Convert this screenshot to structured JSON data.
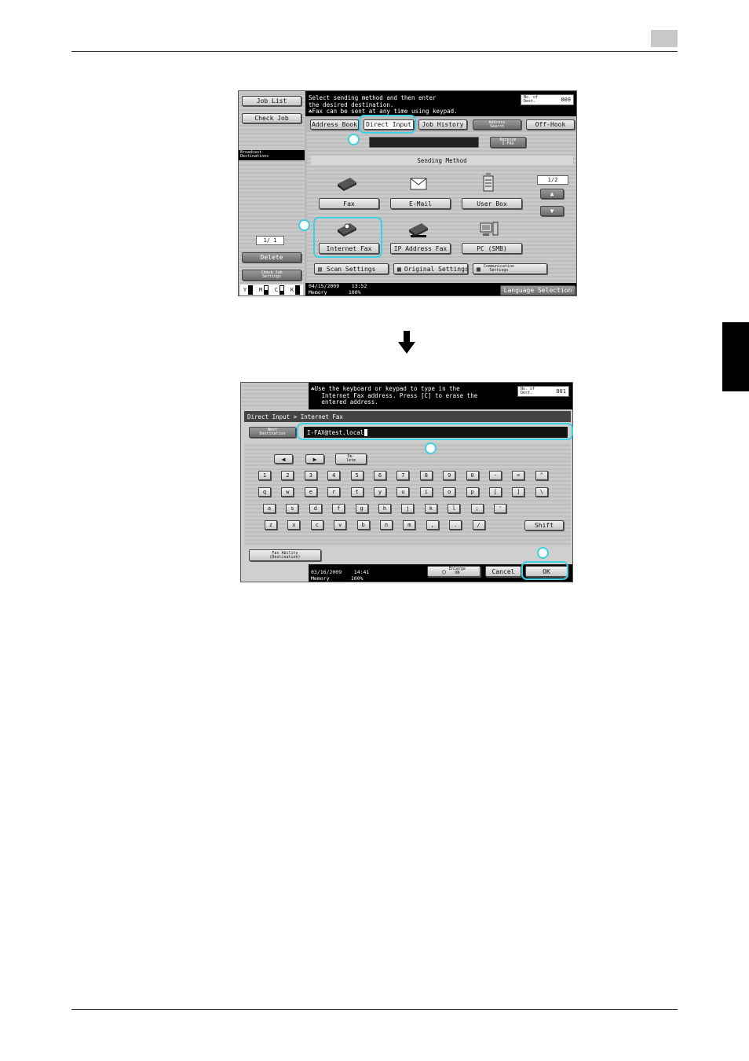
{
  "page": {
    "section_marker_color": "#000000"
  },
  "screen1": {
    "message": "Select sending method and then enter\nthe desired destination.\n☘Fax can be sent at any time using keypad.",
    "dest_count_label": "No. of\nDest.",
    "dest_count_value": "000",
    "job_list": "Job List",
    "check_job": "Check Job",
    "broadcast_label": "Broadcast\nDestinations",
    "counter": "1/  1",
    "delete": "Delete",
    "check_job_settings": "Check Job\nSettings",
    "toner": [
      "Y",
      "M",
      "C",
      "K"
    ],
    "tabs": [
      "Address Book",
      "Direct Input",
      "Job History",
      "Address\nSearch",
      "Off-Hook"
    ],
    "receive_ifax": "Receive\nI-FAX",
    "sending_method_title": "Sending Method",
    "methods": [
      "Fax",
      "E-Mail",
      "User Box",
      "Internet Fax",
      "IP Address Fax",
      "PC (SMB)"
    ],
    "page_indicator": "1/2",
    "bottom_buttons": [
      "Scan Settings",
      "Original Settings",
      "Communication\nSettings"
    ],
    "date": "04/15/2009",
    "time": "13:52",
    "memory_label": "Memory",
    "memory_value": "100%",
    "language_selection": "Language Selection",
    "highlight_color": "#3fd0e0"
  },
  "screen2": {
    "message": "☘Use the keyboard or keypad to type in the\n   Internet Fax address. Press [C] to erase the\n   entered address.",
    "dest_count_label": "No. of\nDest.",
    "dest_count_value": "001",
    "breadcrumb": "Direct Input > Internet Fax",
    "next_destination": "Next\nDestination",
    "address_value": "I-FAX@test.local",
    "delete_key": "De-\nlete",
    "row1": [
      "1",
      "2",
      "3",
      "4",
      "5",
      "6",
      "7",
      "8",
      "9",
      "0",
      "-",
      "=",
      "^"
    ],
    "row2": [
      "q",
      "w",
      "e",
      "r",
      "t",
      "y",
      "u",
      "i",
      "o",
      "p",
      "[",
      "]",
      "\\"
    ],
    "row3": [
      "a",
      "s",
      "d",
      "f",
      "g",
      "h",
      "j",
      "k",
      "l",
      ";",
      "'"
    ],
    "row4": [
      "z",
      "x",
      "c",
      "v",
      "b",
      "n",
      "m",
      ",",
      ".",
      "/"
    ],
    "shift": "Shift",
    "fax_ability": "Fax Ability\n(Destination)",
    "date": "03/16/2009",
    "time": "14:41",
    "memory_label": "Memory",
    "memory_value": "100%",
    "enlarge_on": "Enlarge\nON",
    "cancel": "Cancel",
    "ok": "OK"
  }
}
